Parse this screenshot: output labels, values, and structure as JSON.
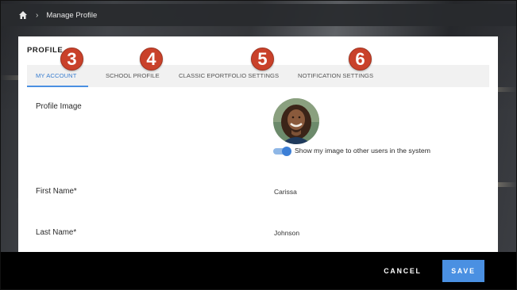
{
  "breadcrumb": {
    "current": "Manage Profile",
    "separator": "›"
  },
  "panel": {
    "title": "PROFILE"
  },
  "tabs": [
    {
      "label": "MY ACCOUNT",
      "active": true
    },
    {
      "label": "SCHOOL PROFILE",
      "active": false
    },
    {
      "label": "CLASSIC EPORTFOLIO SETTINGS",
      "active": false
    },
    {
      "label": "NOTIFICATION SETTINGS",
      "active": false
    }
  ],
  "badges": [
    "3",
    "4",
    "5",
    "6"
  ],
  "fields": {
    "profile_image_label": "Profile Image",
    "show_image_toggle_label": "Show my image to other users in the system",
    "show_image_toggle_on": true,
    "first_name_label": "First Name*",
    "first_name_value": "Carissa",
    "last_name_label": "Last Name*",
    "last_name_value": "Johnson"
  },
  "footer": {
    "cancel_label": "CANCEL",
    "save_label": "SAVE"
  },
  "colors": {
    "accent": "#4a90e2",
    "badge": "#c9412a",
    "footer": "#000000"
  },
  "icons": {
    "home": "home-icon"
  }
}
